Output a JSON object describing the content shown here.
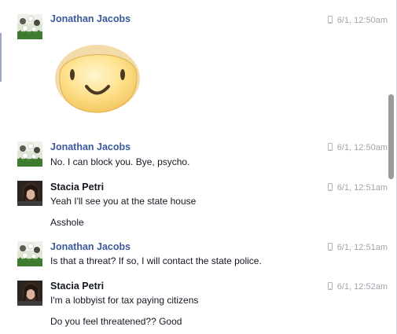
{
  "messages": [
    {
      "sender": "Jonathan Jacobs",
      "time": "6/1, 12:50am",
      "sticker": "smiley-face-sticker",
      "lines": []
    },
    {
      "sender": "Jonathan Jacobs",
      "time": "6/1, 12:50am",
      "lines": [
        "No. I can block you. Bye, psycho."
      ]
    },
    {
      "sender": "Stacia Petri",
      "time": "6/1, 12:51am",
      "lines": [
        "Yeah I'll see you at the state house",
        "Asshole"
      ]
    },
    {
      "sender": "Jonathan Jacobs",
      "time": "6/1, 12:51am",
      "lines": [
        "Is that a threat? If so, I will contact the state police."
      ]
    },
    {
      "sender": "Stacia Petri",
      "time": "6/1, 12:52am",
      "lines": [
        "I'm a lobbyist for tax paying citizens",
        "Do you feel threatened?? Good"
      ]
    }
  ],
  "colors": {
    "link_name": "#3b5998",
    "timestamp": "#a0a4ab",
    "sticker_fill": "#fbd978"
  },
  "icons": {
    "timestamp_device": "mobile-phone-icon"
  }
}
